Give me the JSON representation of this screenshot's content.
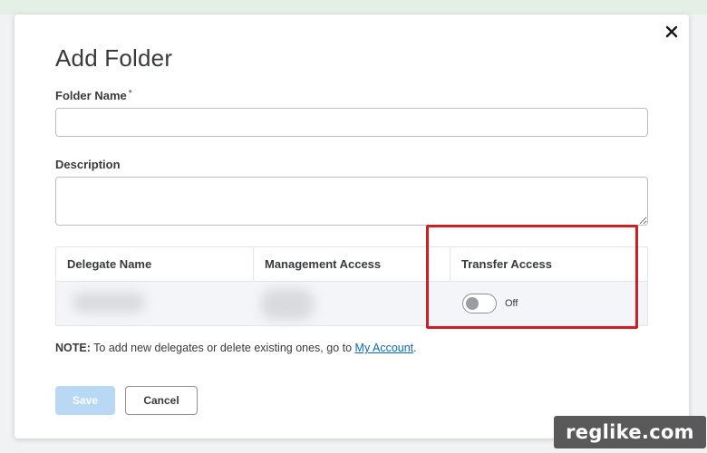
{
  "dialog": {
    "title": "Add Folder",
    "folder_name": {
      "label": "Folder Name",
      "required_mark": "*",
      "value": "",
      "placeholder": ""
    },
    "description": {
      "label": "Description",
      "value": "",
      "placeholder": ""
    },
    "close_icon": "close-icon"
  },
  "delegates_table": {
    "columns": [
      "Delegate Name",
      "Management Access",
      "Transfer Access"
    ],
    "rows": [
      {
        "delegate_name": "",
        "management_access": "",
        "transfer_access": {
          "enabled": false,
          "label": "Off"
        }
      }
    ]
  },
  "note": {
    "prefix": "NOTE:",
    "text": " To add new delegates or delete existing ones, go to ",
    "link": "My Account",
    "suffix": "."
  },
  "buttons": {
    "save": "Save",
    "cancel": "Cancel"
  },
  "watermark": "reglike.com",
  "colors": {
    "highlight": "#cc1f26",
    "save_disabled": "#b9d8f4",
    "link": "#0b6ab0",
    "top_strip": "#e4efe6"
  }
}
